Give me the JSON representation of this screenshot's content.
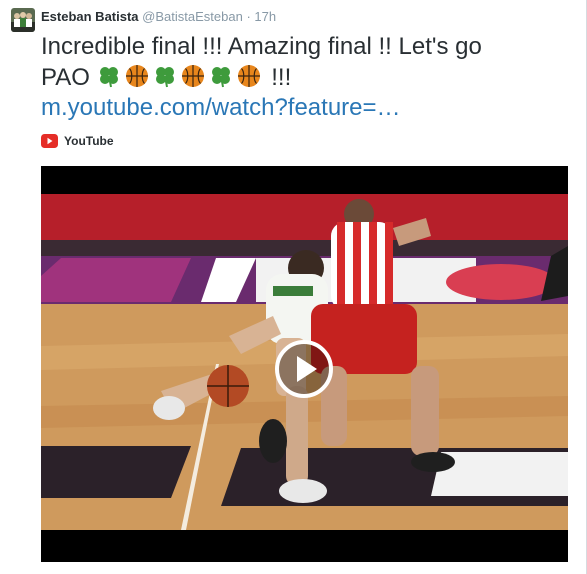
{
  "tweet": {
    "author_name": "Esteban Batista",
    "author_handle": "@BatistaEsteban",
    "separator": "·",
    "time": "17h",
    "text_line1": "Incredible final !!! Amazing final !! Let's go",
    "text_line2_word": "PAO",
    "text_line2_end": "!!!",
    "emojis": [
      "four-leaf-clover",
      "basketball",
      "four-leaf-clover",
      "basketball",
      "four-leaf-clover",
      "basketball"
    ],
    "link": "m.youtube.com/watch?feature=…"
  },
  "card": {
    "source": "YouTube",
    "source_icon": "youtube-icon"
  },
  "video": {
    "play_icon": "play-icon"
  },
  "colors": {
    "name": "#292f33",
    "meta": "#8899a6",
    "link": "#2a77b6",
    "youtube_red": "#e52d27",
    "clover_green": "#3e9b3c",
    "ball_orange": "#e8861c"
  }
}
